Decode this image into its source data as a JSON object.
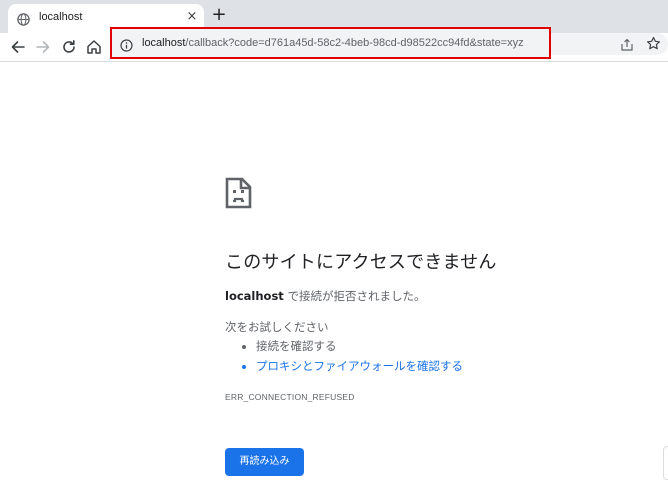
{
  "tab": {
    "title": "localhost",
    "close_glyph": "×",
    "new_tab_glyph": "+"
  },
  "toolbar": {
    "back_icon": "arrow-left-icon",
    "forward_icon": "arrow-right-icon",
    "reload_icon": "reload-icon",
    "home_icon": "home-icon"
  },
  "omnibox": {
    "host": "localhost",
    "path": "/callback?code=d761a45d-58c2-4beb-98cd-d98522cc94fd&state=xyz",
    "highlight_color": "#e00000"
  },
  "error": {
    "title": "このサイトにアクセスできません",
    "desc_host": "localhost",
    "desc_rest": " で接続が拒否されました。",
    "suggest_heading": "次をお試しください",
    "suggestions": [
      {
        "text": "接続を確認する",
        "is_link": false
      },
      {
        "text": "プロキシとファイアウォールを確認する",
        "is_link": true
      }
    ],
    "code": "ERR_CONNECTION_REFUSED",
    "reload_label": "再読み込み"
  },
  "colors": {
    "accent": "#1a73e8",
    "tabstrip_bg": "#dee1e6",
    "omnibox_bg": "#f1f3f4"
  }
}
